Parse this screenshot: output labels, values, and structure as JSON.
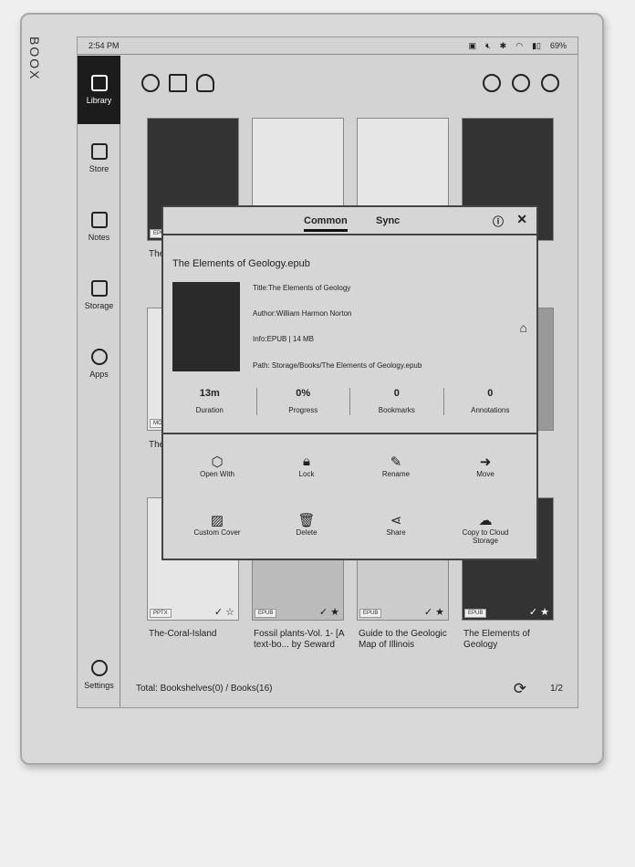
{
  "device": {
    "brand": "BOOX"
  },
  "status": {
    "time": "2:54 PM",
    "battery": "69%",
    "icons": [
      "screen-icon",
      "mute-icon",
      "bluetooth-icon",
      "wifi-icon",
      "battery-icon"
    ]
  },
  "sidebar": {
    "items": [
      {
        "label": "Library",
        "icon": "library-icon",
        "active": true
      },
      {
        "label": "Store",
        "icon": "store-icon"
      },
      {
        "label": "Notes",
        "icon": "notes-icon"
      },
      {
        "label": "Storage",
        "icon": "storage-icon"
      },
      {
        "label": "Apps",
        "icon": "apps-icon"
      },
      {
        "label": "Settings",
        "icon": "settings-icon"
      }
    ]
  },
  "toolbar": {
    "left": [
      "clock-icon",
      "bookshelf-icon",
      "cloud-icon"
    ],
    "right": [
      "search-icon",
      "stats-icon",
      "menu-icon"
    ]
  },
  "books_row1": [
    {
      "title": "The",
      "badge": "EPUB"
    },
    {
      "title": "",
      "badge": ""
    },
    {
      "title": "",
      "badge": ""
    },
    {
      "title": "",
      "badge": ""
    }
  ],
  "books_row2": [
    {
      "title": "The",
      "badge": "MOBI"
    }
  ],
  "books_row3": [
    {
      "title": "The-Coral-Island",
      "badge": "PPTX",
      "starred": false
    },
    {
      "title": "Fossil plants-Vol. 1- [A text-bo... by Seward",
      "badge": "EPUB",
      "starred": true
    },
    {
      "title": "Guide to the Geologic Map of Illinois",
      "badge": "EPUB",
      "starred": true
    },
    {
      "title": "The Elements of Geology",
      "badge": "EPUB",
      "starred": true
    }
  ],
  "footer": {
    "total": "Total: Bookshelves(0) / Books(16)",
    "page": "1/2"
  },
  "dialog": {
    "tabs": [
      "Common",
      "Sync"
    ],
    "file_name": "The Elements of Geology.epub",
    "title": "Title:The Elements of Geology",
    "author": "Author:William Harmon Norton",
    "info": "Info:EPUB | 14 MB",
    "path": "Path: Storage/Books/The Elements of Geology.epub",
    "stats": [
      {
        "value": "13m",
        "label": "Duration"
      },
      {
        "value": "0%",
        "label": "Progress"
      },
      {
        "value": "0",
        "label": "Bookmarks"
      },
      {
        "value": "0",
        "label": "Annotations"
      }
    ],
    "actions": [
      {
        "label": "Open With",
        "icon": "open-with-icon"
      },
      {
        "label": "Lock",
        "icon": "lock-icon"
      },
      {
        "label": "Rename",
        "icon": "rename-icon"
      },
      {
        "label": "Move",
        "icon": "move-icon"
      },
      {
        "label": "Custom Cover",
        "icon": "image-icon"
      },
      {
        "label": "Delete",
        "icon": "trash-icon"
      },
      {
        "label": "Share",
        "icon": "share-icon"
      },
      {
        "label": "Copy to Cloud Storage",
        "icon": "cloud-icon"
      }
    ]
  }
}
